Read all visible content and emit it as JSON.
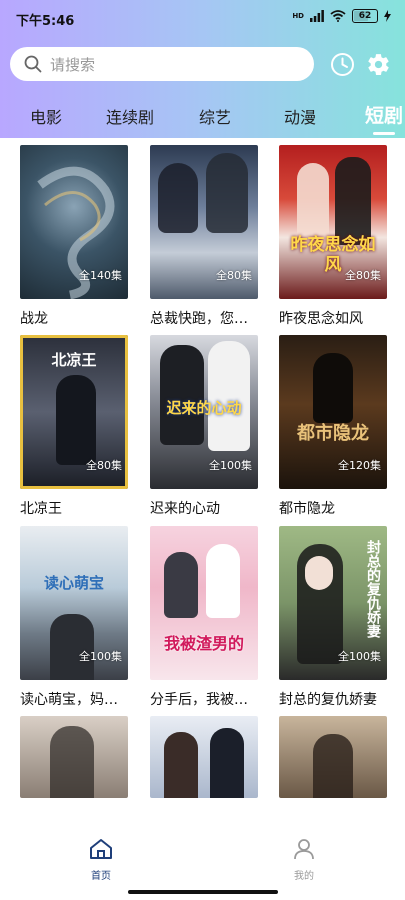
{
  "status_bar": {
    "time": "下午5:46",
    "network": "HD",
    "battery": "62"
  },
  "search": {
    "placeholder": "请搜索"
  },
  "tabs": [
    "电影",
    "连续剧",
    "综艺",
    "动漫",
    "短剧"
  ],
  "active_tab": "短剧",
  "items": [
    {
      "title": "战龙",
      "episodes": "全140集"
    },
    {
      "title": "总裁快跑，您…",
      "episodes": "全80集"
    },
    {
      "title": "昨夜思念如风",
      "episodes": "全80集"
    },
    {
      "title": "北凉王",
      "episodes": "全80集"
    },
    {
      "title": "迟来的心动",
      "episodes": "全100集"
    },
    {
      "title": "都市隐龙",
      "episodes": "全120集"
    },
    {
      "title": "读心萌宝，妈…",
      "episodes": "全100集"
    },
    {
      "title": "分手后，我被…",
      "episodes": ""
    },
    {
      "title": "封总的复仇娇妻",
      "episodes": "全100集"
    },
    {
      "title": "",
      "episodes": ""
    },
    {
      "title": "",
      "episodes": ""
    },
    {
      "title": "",
      "episodes": ""
    }
  ],
  "poster_text": {
    "p3": "昨夜思念如风",
    "p4": "北凉王",
    "p5": "迟来的心动",
    "p6": "都市隐龙",
    "p7": "读心萌宝",
    "p8": "我被渣男的",
    "p9": "封总的复仇娇妻"
  },
  "bottom_nav": {
    "home": "首页",
    "me": "我的"
  }
}
